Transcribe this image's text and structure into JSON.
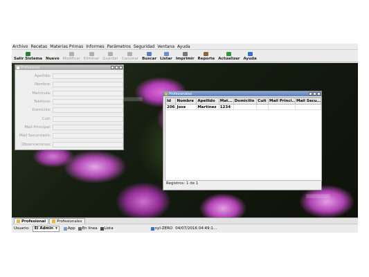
{
  "menubar": [
    "Archivo",
    "Recetas",
    "Materias Primas",
    "Informes",
    "Parámetros",
    "Seguridad",
    "Ventana",
    "Ayuda"
  ],
  "toolbar": [
    {
      "label": "Salir Sistema",
      "icon": "exit-icon",
      "enabled": true,
      "color": "#2e7d32"
    },
    {
      "label": "Nuevo",
      "icon": "new-icon",
      "enabled": true,
      "color": "#f2f2f2"
    },
    {
      "label": "Modificar",
      "icon": "edit-icon",
      "enabled": false,
      "color": "#b0b0b0"
    },
    {
      "label": "Eliminar",
      "icon": "delete-icon",
      "enabled": false,
      "color": "#b0b0b0"
    },
    {
      "label": "Guardar",
      "icon": "save-icon",
      "enabled": false,
      "color": "#b0b0b0"
    },
    {
      "label": "Cancelar",
      "icon": "cancel-icon",
      "enabled": false,
      "color": "#b0b0b0"
    },
    {
      "label": "Buscar",
      "icon": "search-icon",
      "enabled": true,
      "color": "#5a7fc0"
    },
    {
      "label": "Listar",
      "icon": "list-icon",
      "enabled": true,
      "color": "#6b8fd0"
    },
    {
      "label": "Imprimir",
      "icon": "print-icon",
      "enabled": true,
      "color": "#777777"
    },
    {
      "label": "Reporte",
      "icon": "report-icon",
      "enabled": true,
      "color": "#8a6a3a"
    },
    {
      "label": "Actualizar",
      "icon": "refresh-icon",
      "enabled": true,
      "color": "#2e9a3a"
    },
    {
      "label": "Ayuda",
      "icon": "help-icon",
      "enabled": true,
      "color": "#3a6fd0"
    }
  ],
  "form_window": {
    "title": "Profesional",
    "fields": [
      "Apellido:",
      "Nombre:",
      "Matrícula:",
      "Teléfono:",
      "Domicilio:",
      "Cuit:",
      "Mail Principal:",
      "Mail Secundario:",
      "Observaciones:"
    ]
  },
  "list_window": {
    "title": "Profesionales",
    "columns": [
      "Id",
      "Nombre",
      "Apellido",
      "Mat...",
      "Domicilio",
      "Cuit",
      "Mail Princi...",
      "Mail Secu..."
    ],
    "rows": [
      [
        "206",
        "Jose",
        "Martinez",
        "1234",
        "",
        "",
        "",
        ""
      ]
    ],
    "records_label": "Registros: 1 de 1"
  },
  "tabs": [
    {
      "label": "Profesional",
      "selected": true
    },
    {
      "label": "Profesionales",
      "selected": false
    }
  ],
  "status": {
    "user_label": "Usuario:",
    "user_value": "El Admin",
    "app_label": "App",
    "online_label": "En línea",
    "list_label": "Lista",
    "server": "nyl-ZERO",
    "datetime": "04/07/2016 04:49:1..."
  }
}
